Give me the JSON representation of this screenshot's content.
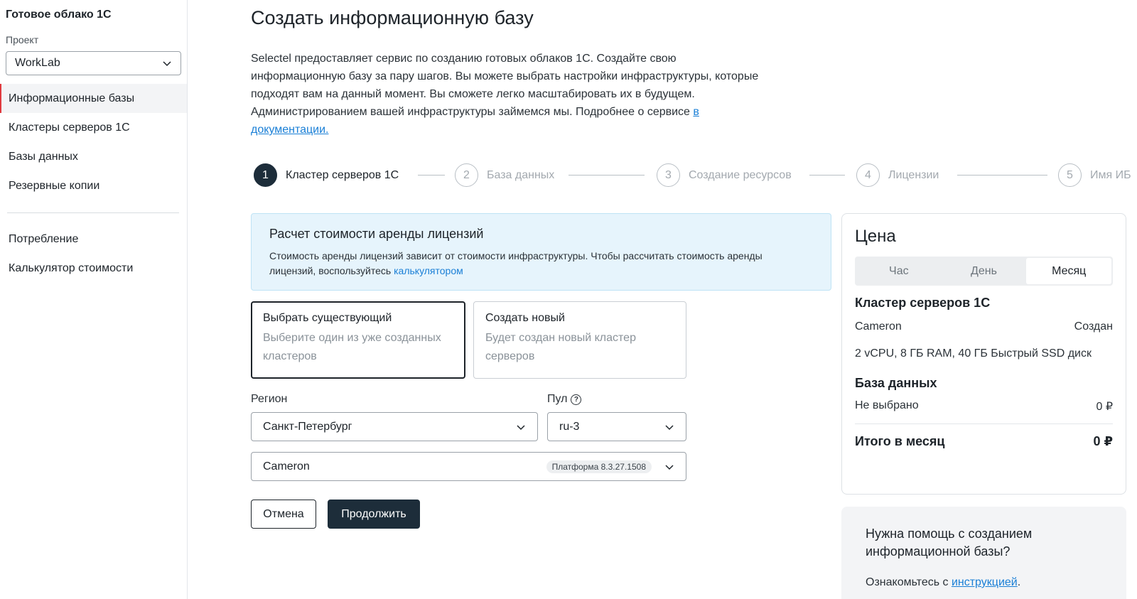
{
  "sidebar": {
    "app_title": "Готовое облако 1С",
    "project_label": "Проект",
    "project_value": "WorkLab",
    "items": [
      {
        "label": "Информационные базы",
        "active": true
      },
      {
        "label": "Кластеры серверов 1С"
      },
      {
        "label": "Базы данных"
      },
      {
        "label": "Резервные копии"
      }
    ],
    "items2": [
      {
        "label": "Потребление"
      },
      {
        "label": "Калькулятор стоимости"
      }
    ]
  },
  "main": {
    "title": "Создать информационную базу",
    "intro": "Selectel предоставляет сервис по созданию готовых облаков 1С. Создайте свою информационную базу за пару шагов. Вы можете выбрать настройки инфраструктуры, которые подходят вам на данный момент. Вы сможете легко масштабировать их в будущем. Администрированием вашей инфраструктуры займемся мы. Подробнее о сервисе ",
    "intro_link": "в документации."
  },
  "stepper": [
    {
      "num": "1",
      "label": "Кластер серверов 1С",
      "state": "active"
    },
    {
      "num": "2",
      "label": "База данных",
      "state": "inactive"
    },
    {
      "num": "3",
      "label": "Создание ресурсов",
      "state": "inactive"
    },
    {
      "num": "4",
      "label": "Лицензии",
      "state": "inactive"
    },
    {
      "num": "5",
      "label": "Имя ИБ",
      "state": "inactive"
    }
  ],
  "banner": {
    "title": "Расчет стоимости аренды лицензий",
    "text": "Стоимость аренды лицензий зависит от стоимости инфраструктуры. Чтобы рассчитать стоимость аренды лицензий, воспользуйтесь ",
    "link": "калькулятором"
  },
  "options": {
    "existing": {
      "title": "Выбрать существующий",
      "desc": "Выберите один из уже созданных кластеров",
      "selected": true
    },
    "create": {
      "title": "Создать новый",
      "desc": "Будет создан новый кластер серверов",
      "selected": false
    }
  },
  "form": {
    "region_label": "Регион",
    "region_value": "Санкт-Петербург",
    "pool_label": "Пул",
    "pool_value": "ru-3",
    "cluster_value": "Cameron",
    "cluster_badge": "Платформа 8.3.27.1508"
  },
  "buttons": {
    "cancel": "Отмена",
    "continue": "Продолжить"
  },
  "price": {
    "title": "Цена",
    "periods": [
      {
        "label": "Час",
        "active": false
      },
      {
        "label": "День",
        "active": false
      },
      {
        "label": "Месяц",
        "active": true
      }
    ],
    "cluster_title": "Кластер серверов 1С",
    "cluster_name": "Cameron",
    "cluster_status": "Создан",
    "cluster_spec": "2 vCPU, 8 ГБ RAM, 40 ГБ Быстрый SSD диск",
    "db_title": "База данных",
    "db_value": "Не выбрано",
    "db_price": "0 ₽",
    "total_label": "Итого в месяц",
    "total_value": "0 ₽"
  },
  "help": {
    "title": "Нужна помощь с созданием информационной базы?",
    "text": "Ознакомьтесь с ",
    "link": "инструкцией",
    "suffix": "."
  },
  "colors": {
    "accent_dark": "#1d2d3a",
    "link": "#1a7fd6",
    "active_marker": "#e0393e",
    "banner_bg": "#e6f4fc"
  }
}
